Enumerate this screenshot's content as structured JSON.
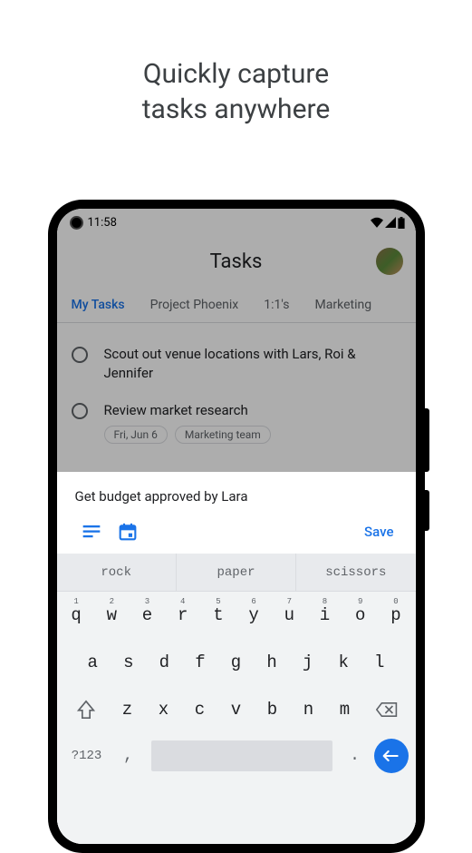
{
  "headline": {
    "line1": "Quickly capture",
    "line2": "tasks anywhere"
  },
  "status": {
    "time": "11:58"
  },
  "app": {
    "title": "Tasks"
  },
  "tabs": [
    {
      "label": "My Tasks",
      "active": true
    },
    {
      "label": "Project Phoenix",
      "active": false
    },
    {
      "label": "1:1's",
      "active": false
    },
    {
      "label": "Marketing",
      "active": false
    }
  ],
  "tasks": [
    {
      "text": "Scout out venue locations with Lars, Roi & Jennifer"
    },
    {
      "text": "Review market research",
      "chips": [
        "Fri, Jun 6",
        "Marketing team"
      ]
    }
  ],
  "sheet": {
    "input_value": "Get budget approved by Lara",
    "save_label": "Save"
  },
  "keyboard": {
    "suggestions": [
      "rock",
      "paper",
      "scissors"
    ],
    "row1_nums": [
      "1",
      "2",
      "3",
      "4",
      "5",
      "6",
      "7",
      "8",
      "9",
      "0"
    ],
    "row1": [
      "q",
      "w",
      "e",
      "r",
      "t",
      "y",
      "u",
      "i",
      "o",
      "p"
    ],
    "row2": [
      "a",
      "s",
      "d",
      "f",
      "g",
      "h",
      "j",
      "k",
      "l"
    ],
    "row3": [
      "z",
      "x",
      "c",
      "v",
      "b",
      "n",
      "m"
    ],
    "sym": "?123",
    "comma": ",",
    "period": "."
  },
  "colors": {
    "accent": "#1a73e8"
  }
}
